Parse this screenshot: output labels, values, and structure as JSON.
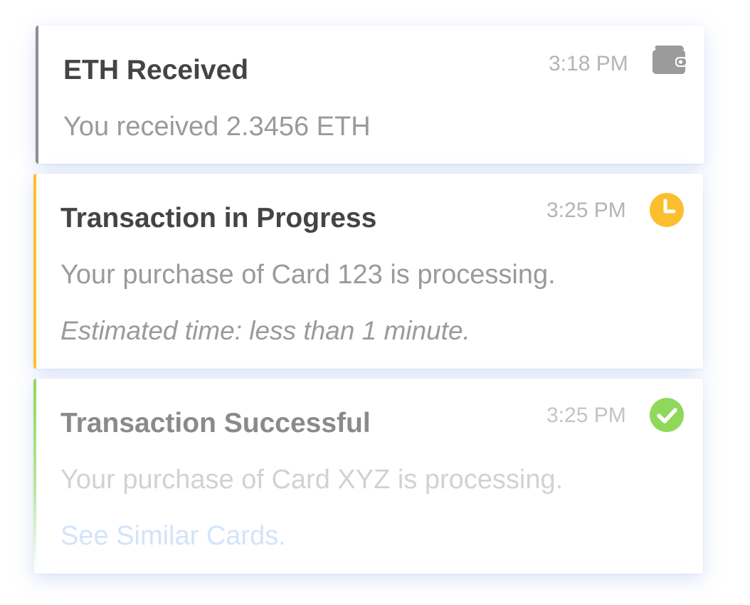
{
  "notifications": [
    {
      "title": "ETH Received",
      "time": "3:18 PM",
      "message": "You received 2.3456 ETH",
      "icon": "wallet-icon",
      "accent_color": "#8e8e8e",
      "icon_color": "#9b9b9b"
    },
    {
      "title": "Transaction in Progress",
      "time": "3:25 PM",
      "message": "Your purchase of Card 123 is processing.",
      "note": "Estimated time: less than 1 minute.",
      "icon": "clock-icon",
      "accent_color": "#fbbf2e",
      "icon_color": "#fbbf2e"
    },
    {
      "title": "Transaction Successful",
      "time": "3:25 PM",
      "message": "Your purchase of Card XYZ is processing.",
      "link": "See Similar Cards.",
      "icon": "check-circle-icon",
      "accent_color": "#8fd85a",
      "icon_color": "#8fd85a"
    }
  ]
}
